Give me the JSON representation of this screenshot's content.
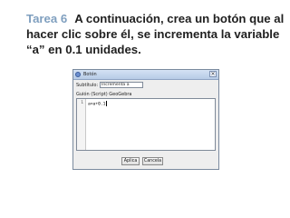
{
  "heading": {
    "task_label": "Tarea 6",
    "instruction": "A continuación, crea un botón que al hacer clic sobre él, se incrementa la variable “a” en 0.1 unidades."
  },
  "dialog": {
    "title": "Botón",
    "close_glyph": "×",
    "subtitle_label": "Subtítulo:",
    "subtitle_value": "Incrementa a",
    "script_label": "Guión (Script) GeoGebra",
    "script_lines": [
      {
        "number": "1",
        "code": "a=a+0.1"
      }
    ],
    "apply_label": "Aplica",
    "cancel_label": "Cancela"
  }
}
